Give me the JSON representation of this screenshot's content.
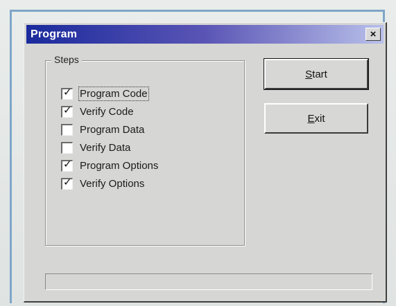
{
  "window": {
    "title": "Program",
    "close_glyph": "×"
  },
  "steps": {
    "legend": "Steps",
    "items": [
      {
        "label": "Program Code",
        "checked": true,
        "focused": true
      },
      {
        "label": "Verify Code",
        "checked": true,
        "focused": false
      },
      {
        "label": "Program Data",
        "checked": false,
        "focused": false
      },
      {
        "label": "Verify Data",
        "checked": false,
        "focused": false
      },
      {
        "label": "Program Options",
        "checked": true,
        "focused": false
      },
      {
        "label": "Verify Options",
        "checked": true,
        "focused": false
      }
    ]
  },
  "buttons": {
    "start": {
      "mnemonic": "S",
      "rest": "tart"
    },
    "exit": {
      "mnemonic": "E",
      "rest": "xit"
    }
  },
  "progress": {
    "fraction": 0
  },
  "colors": {
    "titlebar_start": "#1a2a9c",
    "titlebar_end": "#b9c0ea",
    "window_face": "#d6d6d4"
  }
}
